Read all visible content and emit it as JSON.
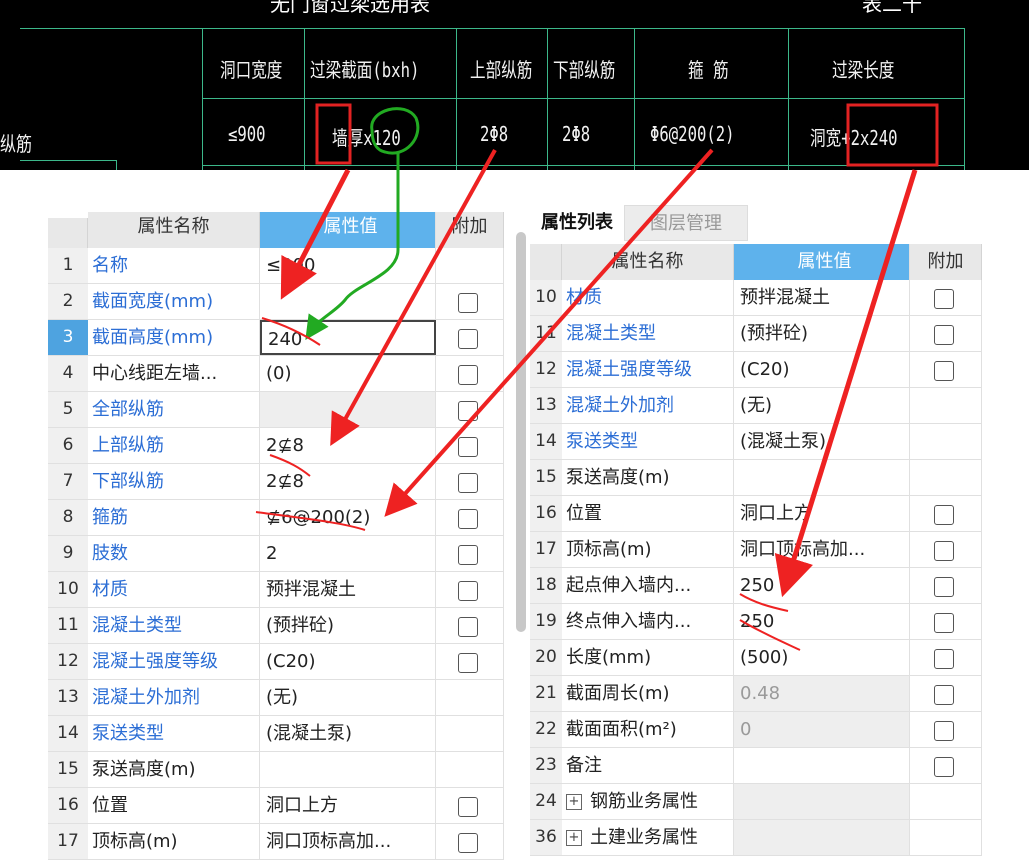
{
  "cad_table": {
    "clipped_title": "无门窗过梁选用表",
    "clipped_right": "表二十",
    "left_label": "纵筋",
    "headers": [
      "洞口宽度",
      "过梁截面(bxh)",
      "上部纵筋",
      "下部纵筋",
      "箍 筋",
      "过梁长度"
    ],
    "row": [
      "≤900",
      "墙厚x120",
      "2Φ8",
      "2Φ8",
      "Φ6@200(2)",
      "洞宽+2x240"
    ]
  },
  "left_panel": {
    "headers": {
      "name": "属性名称",
      "value": "属性值",
      "extra": "附加"
    },
    "rows": [
      {
        "no": "1",
        "name": "名称",
        "value": "≤900",
        "blue": true,
        "check": false
      },
      {
        "no": "2",
        "name": "截面宽度(mm)",
        "value": "",
        "blue": true,
        "check": true
      },
      {
        "no": "3",
        "name": "截面高度(mm)",
        "value": "240",
        "blue": true,
        "check": true,
        "selected": true
      },
      {
        "no": "4",
        "name": "中心线距左墙...",
        "value": "(0)",
        "blue": false,
        "check": true
      },
      {
        "no": "5",
        "name": "全部纵筋",
        "value": "",
        "blue": true,
        "check": true,
        "gray": true
      },
      {
        "no": "6",
        "name": "上部纵筋",
        "value": "2⊈8",
        "blue": true,
        "check": true
      },
      {
        "no": "7",
        "name": "下部纵筋",
        "value": "2⊈8",
        "blue": true,
        "check": true
      },
      {
        "no": "8",
        "name": "箍筋",
        "value": "⊈6@200(2)",
        "blue": true,
        "check": true
      },
      {
        "no": "9",
        "name": "肢数",
        "value": "2",
        "blue": true,
        "check": true
      },
      {
        "no": "10",
        "name": "材质",
        "value": "预拌混凝土",
        "blue": true,
        "check": true
      },
      {
        "no": "11",
        "name": "混凝土类型",
        "value": "(预拌砼)",
        "blue": true,
        "check": true
      },
      {
        "no": "12",
        "name": "混凝土强度等级",
        "value": "(C20)",
        "blue": true,
        "check": true
      },
      {
        "no": "13",
        "name": "混凝土外加剂",
        "value": "(无)",
        "blue": true,
        "check": false
      },
      {
        "no": "14",
        "name": "泵送类型",
        "value": "(混凝土泵)",
        "blue": true,
        "check": false
      },
      {
        "no": "15",
        "name": "泵送高度(m)",
        "value": "",
        "blue": false,
        "check": false
      },
      {
        "no": "16",
        "name": "位置",
        "value": "洞口上方",
        "blue": false,
        "check": true
      },
      {
        "no": "17",
        "name": "顶标高(m)",
        "value": "洞口顶标高加...",
        "blue": false,
        "check": true
      }
    ]
  },
  "right_panel": {
    "tabs": [
      "属性列表",
      "图层管理"
    ],
    "headers": {
      "name": "属性名称",
      "value": "属性值",
      "extra": "附加"
    },
    "rows": [
      {
        "no": "10",
        "name": "材质",
        "value": "预拌混凝土",
        "blue": true,
        "check": true
      },
      {
        "no": "11",
        "name": "混凝土类型",
        "value": "(预拌砼)",
        "blue": true,
        "check": true
      },
      {
        "no": "12",
        "name": "混凝土强度等级",
        "value": "(C20)",
        "blue": true,
        "check": true
      },
      {
        "no": "13",
        "name": "混凝土外加剂",
        "value": "(无)",
        "blue": true,
        "check": false
      },
      {
        "no": "14",
        "name": "泵送类型",
        "value": "(混凝土泵)",
        "blue": true,
        "check": false
      },
      {
        "no": "15",
        "name": "泵送高度(m)",
        "value": "",
        "blue": false,
        "check": false
      },
      {
        "no": "16",
        "name": "位置",
        "value": "洞口上方",
        "blue": false,
        "check": true
      },
      {
        "no": "17",
        "name": "顶标高(m)",
        "value": "洞口顶标高加...",
        "blue": false,
        "check": true
      },
      {
        "no": "18",
        "name": "起点伸入墙内...",
        "value": "250",
        "blue": false,
        "check": true
      },
      {
        "no": "19",
        "name": "终点伸入墙内...",
        "value": "250",
        "blue": false,
        "check": true
      },
      {
        "no": "20",
        "name": "长度(mm)",
        "value": "(500)",
        "blue": false,
        "check": true
      },
      {
        "no": "21",
        "name": "截面周长(m)",
        "value": "0.48",
        "blue": false,
        "check": true,
        "gray": true,
        "muted": true
      },
      {
        "no": "22",
        "name": "截面面积(m²)",
        "value": "0",
        "blue": false,
        "check": true,
        "gray": true,
        "muted": true
      },
      {
        "no": "23",
        "name": "备注",
        "value": "",
        "blue": false,
        "check": true
      },
      {
        "no": "24",
        "name": "钢筋业务属性",
        "value": "",
        "blue": false,
        "check": false,
        "expand": true,
        "gray": true
      },
      {
        "no": "36",
        "name": "土建业务属性",
        "value": "",
        "blue": false,
        "check": false,
        "expand": true,
        "gray": true
      }
    ]
  },
  "annotation_colors": {
    "arrow": "#ee2222",
    "green": "#22aa22",
    "box": "#e22222"
  }
}
